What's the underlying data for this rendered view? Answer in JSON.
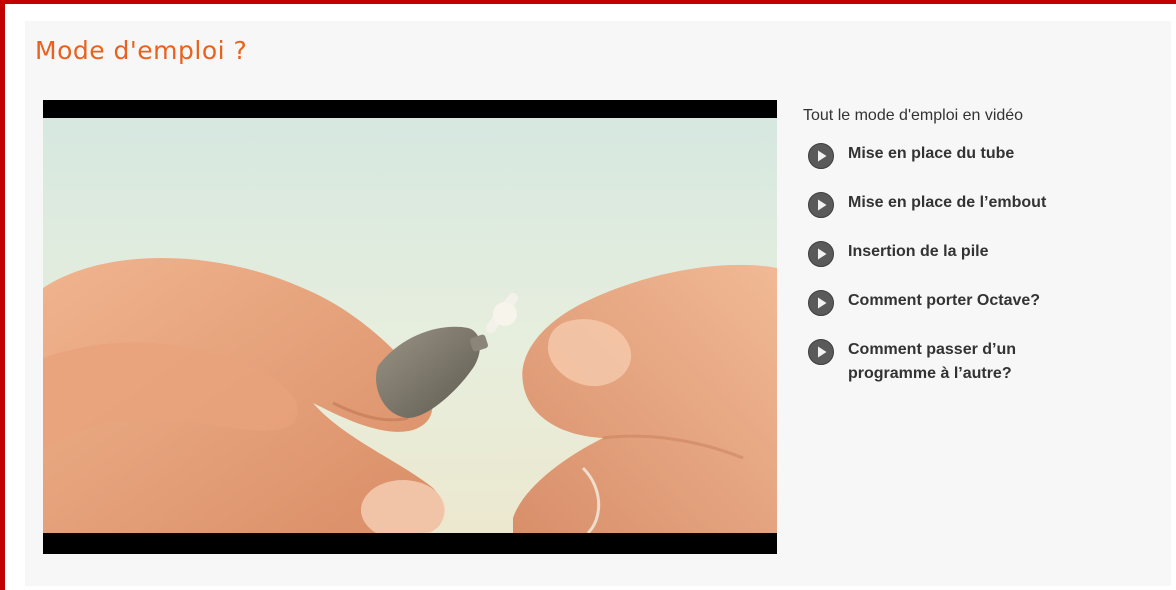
{
  "section": {
    "title": "Mode d'emploi ?"
  },
  "video": {
    "thumbnail_icon": "hands-fitting-hearing-aid-tube"
  },
  "sidebar": {
    "heading": "Tout le mode d'emploi en vidéo",
    "items": [
      {
        "label": "Mise en place du tube",
        "icon": "play-icon"
      },
      {
        "label": "Mise en place de l’embout",
        "icon": "play-icon"
      },
      {
        "label": "Insertion de la pile",
        "icon": "play-icon"
      },
      {
        "label": "Comment porter Octave?",
        "icon": "play-icon"
      },
      {
        "label": "Comment passer d’un programme à l’autre?",
        "icon": "play-icon"
      }
    ]
  },
  "colors": {
    "frame_border": "#c00000",
    "title": "#e8621e",
    "text": "#333333",
    "panel_background": "#f7f7f7"
  }
}
